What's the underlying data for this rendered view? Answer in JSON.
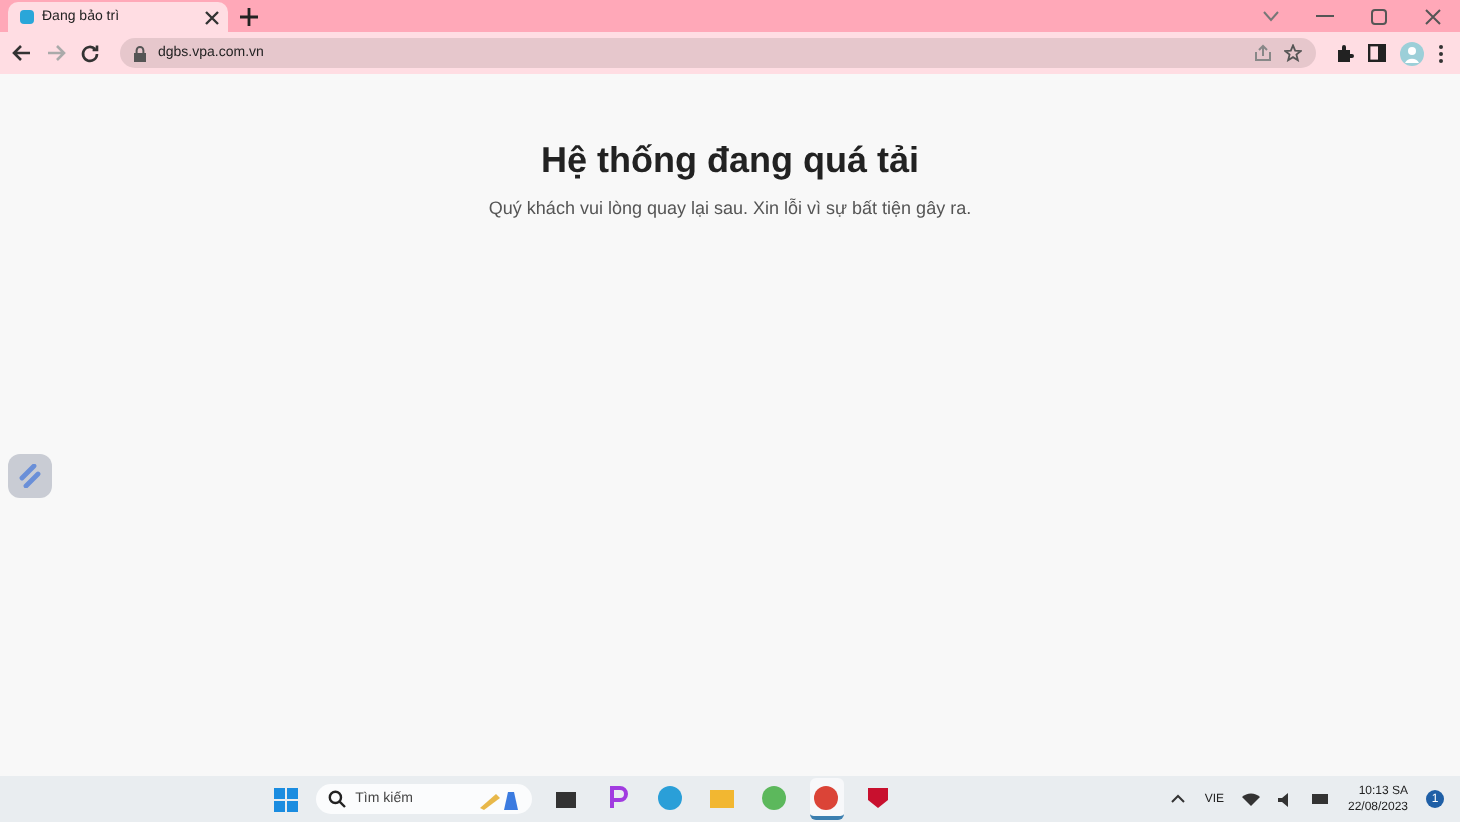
{
  "browser": {
    "tabs": [
      {
        "title": "Đang bảo trì",
        "selected": true
      }
    ],
    "address": "dgbs.vpa.com.vn"
  },
  "page": {
    "heading": "Hệ thống đang quá tải",
    "message": "Quý khách vui lòng quay lại sau. Xin lỗi vì sự bất tiện gây ra."
  },
  "taskbar": {
    "search_placeholder": "Tìm kiếm",
    "apps": [
      {
        "kind": "files",
        "active": false
      },
      {
        "kind": "paint",
        "active": false
      },
      {
        "kind": "telegram",
        "active": false
      },
      {
        "kind": "folder",
        "active": false
      },
      {
        "kind": "green",
        "active": false
      },
      {
        "kind": "chrome",
        "active": true
      },
      {
        "kind": "shield",
        "active": false
      }
    ],
    "language": "VIE",
    "time": "10:13 SA",
    "date": "22/08/2023",
    "notifications": "1"
  }
}
